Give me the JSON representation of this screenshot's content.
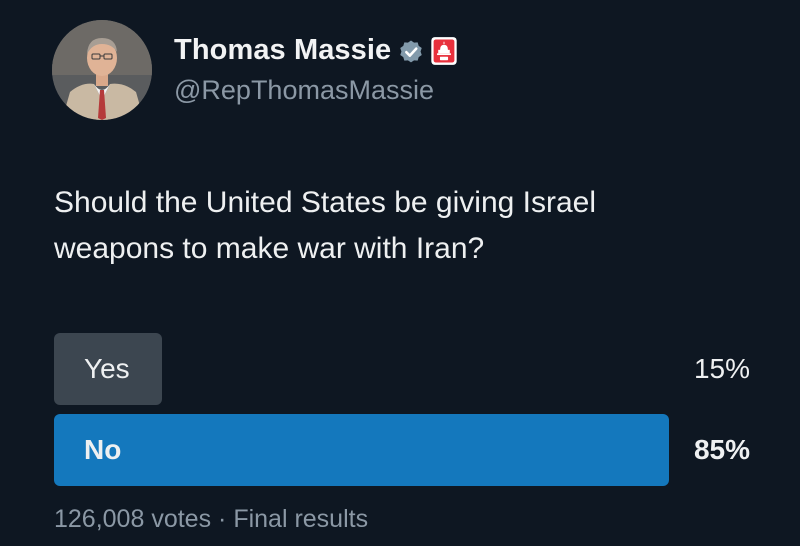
{
  "author": {
    "display_name": "Thomas Massie",
    "handle": "@RepThomasMassie",
    "verified_icon": "verified-badge-icon",
    "affiliation_badge": "us-capitol-badge-icon",
    "accent_color": "#8b98a5"
  },
  "post": {
    "text_line1": "Should the United States be giving Israel",
    "text_line2": "weapons to make war with Iran?"
  },
  "poll": {
    "options": [
      {
        "label": "Yes",
        "percent_label": "15%",
        "share": 0.15,
        "winner": false,
        "bar_color": "#3c4650"
      },
      {
        "label": "No",
        "percent_label": "85%",
        "share": 0.85,
        "winner": true,
        "bar_color": "#1478bd"
      }
    ],
    "votes": "126,008 votes",
    "separator": "·",
    "status": "Final results"
  }
}
